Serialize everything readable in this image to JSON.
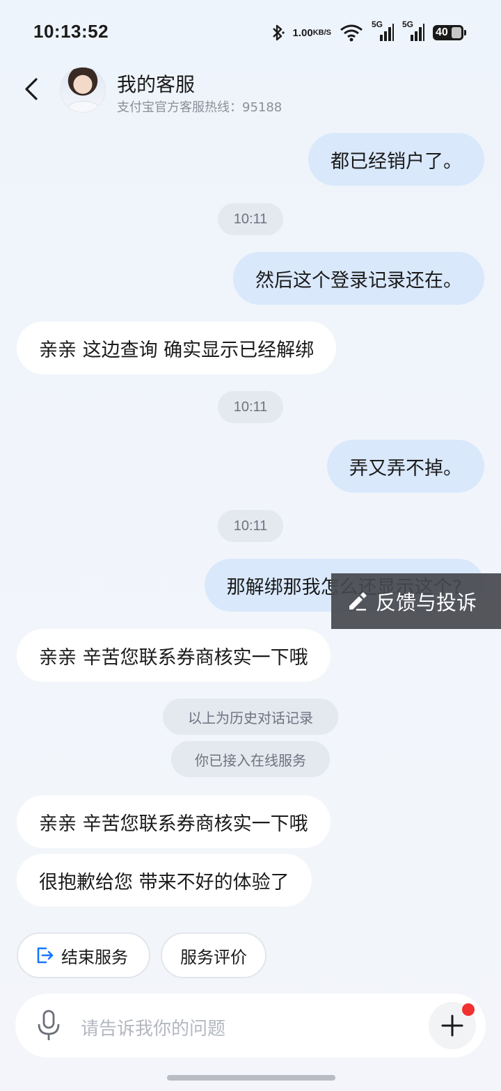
{
  "status_bar": {
    "time": "10:13:52",
    "net_speed_value": "1.00",
    "net_speed_unit": "KB/S",
    "signal1_label": "5G",
    "signal2_label": "5G",
    "battery_level": "40"
  },
  "header": {
    "title": "我的客服",
    "subtitle": "支付宝官方客服热线：95188"
  },
  "messages": [
    {
      "text": "都已经销户了。"
    },
    {
      "text": "10:11"
    },
    {
      "text": "然后这个登录记录还在。"
    },
    {
      "text": "亲亲 这边查询 确实显示已经解绑"
    },
    {
      "text": "10:11"
    },
    {
      "text": "弄又弄不掉。"
    },
    {
      "text": "10:11"
    },
    {
      "text": "那解绑那我怎么还显示这个?"
    },
    {
      "text": "亲亲 辛苦您联系券商核实一下哦"
    },
    {
      "text": "以上为历史对话记录"
    },
    {
      "text": "你已接入在线服务"
    },
    {
      "text": "亲亲 辛苦您联系券商核实一下哦"
    },
    {
      "text": "很抱歉给您 带来不好的体验了"
    }
  ],
  "feedback_button": "反馈与投诉",
  "actions": {
    "end_service": "结束服务",
    "rate_service": "服务评价"
  },
  "input": {
    "placeholder": "请告诉我你的问题"
  },
  "colors": {
    "user_bubble": "#d9e8fb",
    "bot_bubble": "#ffffff",
    "accent": "#1677ff",
    "badge": "#f23030"
  }
}
